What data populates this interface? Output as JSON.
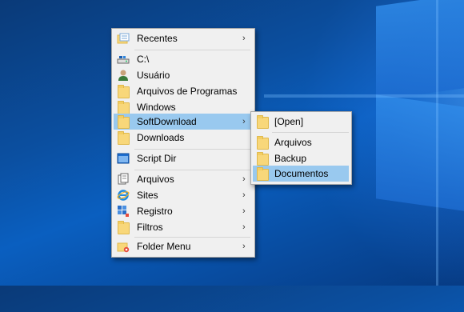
{
  "menu": {
    "items": [
      {
        "label": "Recentes",
        "icon": "recent-folders-icon",
        "submenu": true
      },
      {
        "label": "C:\\",
        "icon": "drive-icon",
        "submenu": false
      },
      {
        "label": "Usuário",
        "icon": "user-icon",
        "submenu": false
      },
      {
        "label": "Arquivos de Programas",
        "icon": "folder-icon",
        "submenu": false
      },
      {
        "label": "Windows",
        "icon": "folder-icon",
        "submenu": false
      },
      {
        "label": "SoftDownload",
        "icon": "folder-icon",
        "submenu": true,
        "highlighted": true
      },
      {
        "label": "Downloads",
        "icon": "folder-icon",
        "submenu": false
      },
      {
        "label": "Script Dir",
        "icon": "script-window-icon",
        "submenu": false
      },
      {
        "label": "Arquivos",
        "icon": "files-icon",
        "submenu": true
      },
      {
        "label": "Sites",
        "icon": "internet-explorer-icon",
        "submenu": true
      },
      {
        "label": "Registro",
        "icon": "registry-icon",
        "submenu": true
      },
      {
        "label": "Filtros",
        "icon": "folder-icon",
        "submenu": true
      },
      {
        "label": "Folder Menu",
        "icon": "folder-menu-icon",
        "submenu": true
      }
    ]
  },
  "submenu": {
    "items": [
      {
        "label": "[Open]",
        "icon": "folder-icon"
      },
      {
        "label": "Arquivos",
        "icon": "folder-icon"
      },
      {
        "label": "Backup",
        "icon": "folder-icon"
      },
      {
        "label": "Documentos",
        "icon": "folder-icon",
        "highlighted": true
      }
    ]
  },
  "arrow_glyph": "›",
  "colors": {
    "menu_bg": "#f0f0f0",
    "highlight": "#99c9ef",
    "desktop": "#0b4fa0"
  }
}
